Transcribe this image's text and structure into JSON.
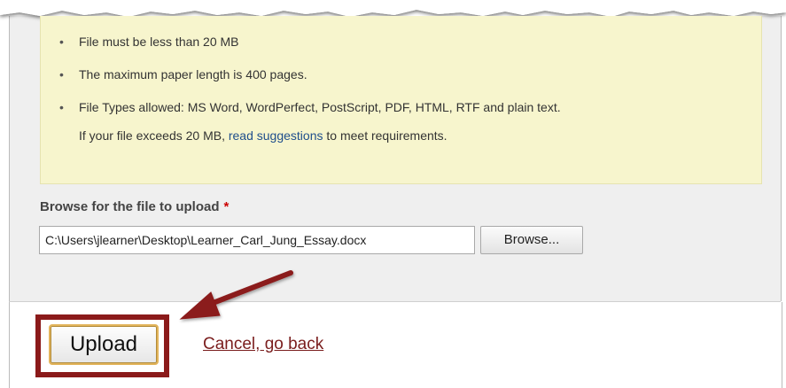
{
  "requirements": {
    "items": [
      "File must be less than 20 MB",
      "The maximum paper length is 400 pages.",
      "File Types allowed: MS Word, WordPerfect, PostScript, PDF, HTML, RTF and plain text."
    ],
    "bullet": "•",
    "exceed_prefix": "If your file exceeds 20 MB, ",
    "exceed_link": "read suggestions",
    "exceed_suffix": " to meet requirements."
  },
  "upload_field": {
    "label": "Browse for the file to upload",
    "required_marker": "*",
    "value": "C:\\Users\\jlearner\\Desktop\\Learner_Carl_Jung_Essay.docx",
    "browse_label": "Browse..."
  },
  "actions": {
    "upload_label": "Upload",
    "cancel_label": "Cancel, go back"
  },
  "colors": {
    "requirements_bg": "#f7f5cd",
    "highlight": "#8b1a1a",
    "link": "#1f4e8c",
    "cancel_link": "#7a1d1d",
    "required": "#cc0000"
  },
  "icons": {
    "annotation_arrow": "arrow-pointing-to-upload"
  }
}
